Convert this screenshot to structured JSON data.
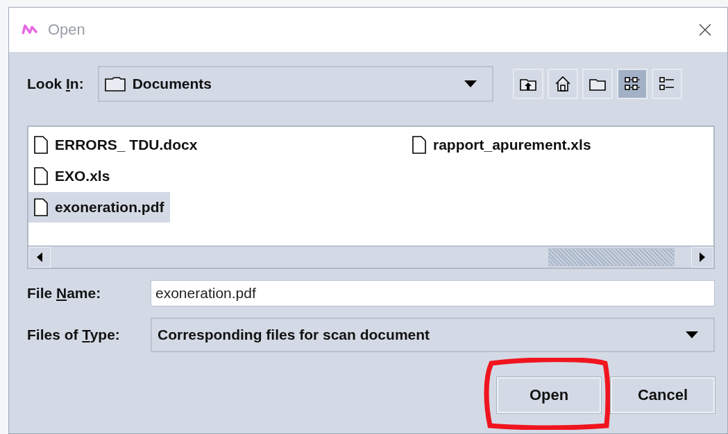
{
  "window": {
    "title": "Open"
  },
  "look_in": {
    "label_parts": [
      "Look ",
      "I",
      "n:"
    ],
    "value": "Documents"
  },
  "toolbar": [
    {
      "kind": "up",
      "selected": false
    },
    {
      "kind": "home",
      "selected": false
    },
    {
      "kind": "new-folder",
      "selected": false
    },
    {
      "kind": "list",
      "selected": true
    },
    {
      "kind": "details",
      "selected": false
    }
  ],
  "files": [
    {
      "name": "ERRORS_ TDU.docx",
      "selected": false
    },
    {
      "name": "EXO.xls",
      "selected": false
    },
    {
      "name": "exoneration.pdf",
      "selected": true
    },
    {
      "name": "rapport_apurement.xls",
      "selected": false
    }
  ],
  "file_name": {
    "label_parts": [
      "File ",
      "N",
      "ame:"
    ],
    "value": "exoneration.pdf"
  },
  "files_of_type": {
    "label_parts": [
      "Files of ",
      "T",
      "ype:"
    ],
    "value": "Corresponding files for scan document"
  },
  "buttons": [
    {
      "label": "Open"
    },
    {
      "label": "Cancel"
    }
  ],
  "annotation": {
    "kind": "circle"
  }
}
